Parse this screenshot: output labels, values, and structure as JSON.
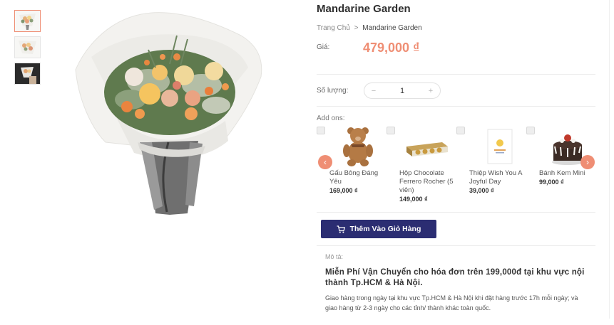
{
  "product": {
    "title": "Mandarine Garden",
    "price_label": "Giá:",
    "price": "479,000 ₫"
  },
  "breadcrumb": {
    "home": "Trang Chủ",
    "separator": ">",
    "current": "Mandarine Garden"
  },
  "quantity": {
    "label": "Số lượng:",
    "value": "1",
    "minus": "−",
    "plus": "+"
  },
  "addons": {
    "label": "Add ons:",
    "items": [
      {
        "name": "Gấu Bông Đáng Yêu",
        "price": "169,000 ₫",
        "icon": "teddy-bear-icon"
      },
      {
        "name": "Hộp Chocolate Ferrero Rocher (5 viên)",
        "price": "149,000 ₫",
        "icon": "chocolate-box-icon"
      },
      {
        "name": "Thiệp Wish You A Joyful Day",
        "price": "39,000 ₫",
        "icon": "greeting-card-icon"
      },
      {
        "name": "Bánh Kem Mini",
        "price": "99,000 ₫",
        "icon": "cake-icon"
      }
    ]
  },
  "cart": {
    "label": "Thêm Vào Giỏ Hàng",
    "icon": "cart-icon"
  },
  "description": {
    "label": "Mô tả:",
    "heading": "Miễn Phí Vận Chuyển cho hóa đơn trên 199,000đ tại khu vực nội thành Tp.HCM & Hà Nội.",
    "body": "Giao hàng trong ngày tại khu vực Tp.HCM & Hà Nội khi đặt hàng trước 17h mỗi ngày; và giao hàng từ 2-3 ngày cho các tỉnh/ thành khác toàn quốc."
  },
  "colors": {
    "accent": "#ef8e74",
    "button": "#2b2d72",
    "text": "#333333"
  }
}
